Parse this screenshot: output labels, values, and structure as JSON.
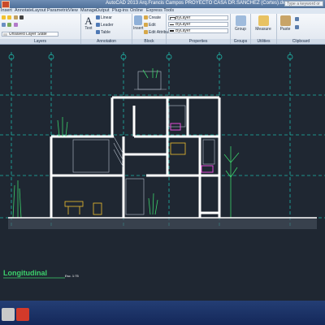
{
  "window": {
    "title": "AutoCAD 2013   Arq.Francis Campos PROYECTO CASA DR.SANCHEZ (Cortes).dwg"
  },
  "search": {
    "placeholder": "Type a keyword or phrase"
  },
  "menu": {
    "items": [
      "Insert",
      "Annotate",
      "Layout",
      "Parametric",
      "View",
      "Manage",
      "Output",
      "Plug-ins",
      "Online",
      "Express Tools"
    ]
  },
  "ribbon": {
    "layers": {
      "title": "Layers",
      "state": "Unsaved Layer State"
    },
    "annotation": {
      "title": "Annotation",
      "text": "Text",
      "linear": "Linear",
      "leader": "Leader",
      "table": "Table"
    },
    "block": {
      "title": "Block",
      "insert": "Insert",
      "create": "Create",
      "edit": "Edit",
      "edit_attributes": "Edit Attributes"
    },
    "properties": {
      "title": "Properties",
      "bylayer_color": "ByLayer",
      "bylayer_line": "ByLayer",
      "bylayer_weight": "ByLayer"
    },
    "groups": {
      "title": "Groups",
      "group": "Group"
    },
    "utilities": {
      "title": "Utilities",
      "measure": "Measure"
    },
    "clipboard": {
      "title": "Clipboard",
      "paste": "Paste"
    }
  },
  "drawing": {
    "label": "Longitudinal",
    "scale": "Esc. 1:75"
  },
  "colors": {
    "accent_cyan": "#1fb5a8",
    "walls": "#ffffff",
    "magenta": "#e34bd6",
    "green_label": "#3cd26b"
  }
}
